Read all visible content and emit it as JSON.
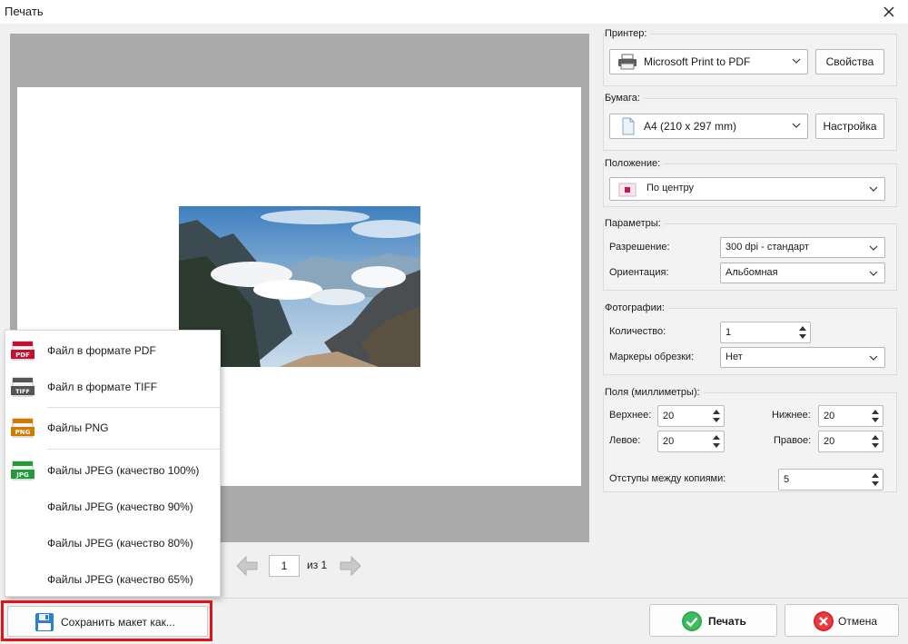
{
  "window": {
    "title": "Печать"
  },
  "preview": {
    "page_current": "1",
    "page_of": "из 1"
  },
  "export_menu": {
    "items": [
      {
        "label": "Файл в формате PDF",
        "badge": "PDF",
        "color": "#c8102e"
      },
      {
        "label": "Файл в формате TIFF",
        "badge": "TIFF",
        "color": "#555555"
      },
      {
        "label": "Файлы PNG",
        "badge": "PNG",
        "color": "#d27a00"
      },
      {
        "label": "Файлы JPEG (качество 100%)",
        "badge": "JPG",
        "color": "#1f9d3a"
      },
      {
        "label": "Файлы JPEG (качество 90%)"
      },
      {
        "label": "Файлы JPEG (качество 80%)"
      },
      {
        "label": "Файлы JPEG (качество 65%)"
      }
    ]
  },
  "buttons": {
    "save_layout": "Сохранить макет как...",
    "print": "Печать",
    "cancel": "Отмена"
  },
  "printer": {
    "title": "Принтер:",
    "value": "Microsoft Print to PDF",
    "properties": "Свойства"
  },
  "paper": {
    "title": "Бумага:",
    "value": "A4 (210 x 297 mm)",
    "setup": "Настройка"
  },
  "position": {
    "title": "Положение:",
    "value": "По центру"
  },
  "params": {
    "title": "Параметры:",
    "resolution_label": "Разрешение:",
    "resolution_value": "300 dpi - стандарт",
    "orientation_label": "Ориентация:",
    "orientation_value": "Альбомная"
  },
  "photos": {
    "title": "Фотографии:",
    "count_label": "Количество:",
    "count_value": "1",
    "crop_label": "Маркеры обрезки:",
    "crop_value": "Нет"
  },
  "margins": {
    "title": "Поля (миллиметры):",
    "top_label": "Верхнее:",
    "top_value": "20",
    "bottom_label": "Нижнее:",
    "bottom_value": "20",
    "left_label": "Левое:",
    "left_value": "20",
    "right_label": "Правое:",
    "right_value": "20",
    "gap_label": "Отступы между копиями:",
    "gap_value": "5"
  },
  "colors": {
    "accent_red": "#e3131b",
    "preview_gray": "#aaaaaa",
    "ok_green": "#2fa84f",
    "cancel_red": "#d9262c"
  },
  "icons": {
    "close": "close-icon",
    "printer": "printer-icon",
    "paper": "paper-icon",
    "position": "position-icon",
    "prev": "arrow-left-icon",
    "next": "arrow-right-icon",
    "save": "floppy-disk-icon",
    "print": "check-circle-icon",
    "cancel": "cancel-circle-icon"
  }
}
